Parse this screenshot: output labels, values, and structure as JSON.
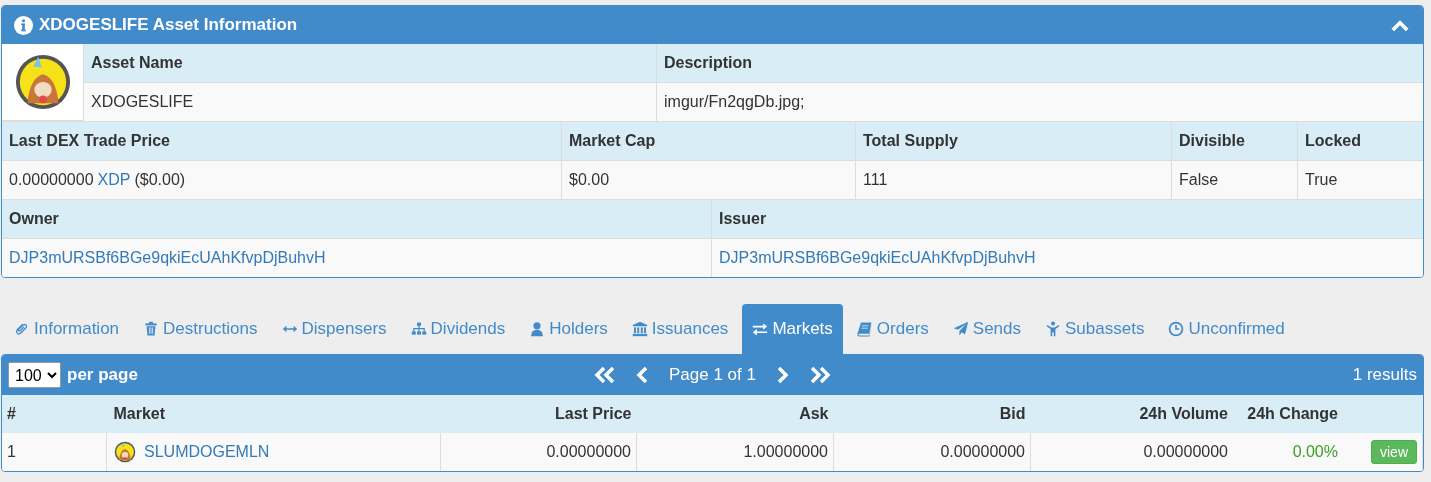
{
  "asset_panel": {
    "title": "XDOGESLIFE Asset Information",
    "expanded": true,
    "name_label": "Asset Name",
    "name": "XDOGESLIFE",
    "description_label": "Description",
    "description": "imgur/Fn2qgDb.jpg;",
    "stats": [
      {
        "label": "Last DEX Trade Price",
        "value": "0.00000000",
        "link": "XDP",
        "suffix": "($0.00)"
      },
      {
        "label": "Market Cap",
        "value": "$0.00"
      },
      {
        "label": "Total Supply",
        "value": "111"
      },
      {
        "label": "Divisible",
        "value": "False"
      },
      {
        "label": "Locked",
        "value": "True"
      }
    ],
    "owner_label": "Owner",
    "owner": "DJP3mURSBf6BGe9qkiEcUAhKfvpDjBuhvH",
    "issuer_label": "Issuer",
    "issuer": "DJP3mURSBf6BGe9qkiEcUAhKfvpDjBuhvH"
  },
  "tabs": [
    {
      "label": "Information",
      "selected": false
    },
    {
      "label": "Destructions",
      "selected": false
    },
    {
      "label": "Dispensers",
      "selected": false
    },
    {
      "label": "Dividends",
      "selected": false
    },
    {
      "label": "Holders",
      "selected": false
    },
    {
      "label": "Issuances",
      "selected": false
    },
    {
      "label": "Markets",
      "selected": true
    },
    {
      "label": "Orders",
      "selected": false
    },
    {
      "label": "Sends",
      "selected": false
    },
    {
      "label": "Subassets",
      "selected": false
    },
    {
      "label": "Unconfirmed",
      "selected": false
    }
  ],
  "toolbar": {
    "per_page": "100",
    "per_page_label": "per page",
    "page": "Page 1 of 1",
    "results": "1 results"
  },
  "table": {
    "columns": [
      "#",
      "Market",
      "Last Price",
      "Ask",
      "Bid",
      "24h Volume",
      "24h Change"
    ],
    "rows": [
      {
        "cells": [
          "1",
          "SLUMDOGEMLN",
          "0.00000000",
          "1.00000000",
          "0.00000000",
          "0.00000000",
          "0.00%"
        ],
        "action": "view"
      }
    ]
  }
}
